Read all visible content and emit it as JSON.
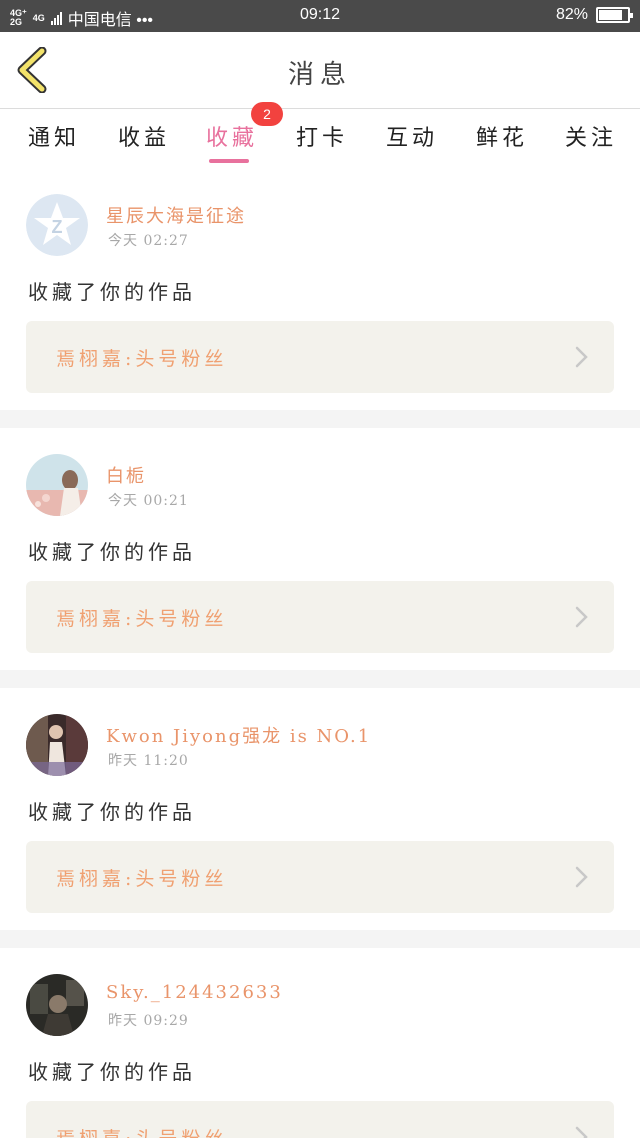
{
  "status_bar": {
    "network_a": "4G⁺",
    "network_b": "4G",
    "network_c": "2G",
    "carrier": "中国电信 •••",
    "time": "09:12",
    "battery_text": "82%",
    "battery_level": 0.82
  },
  "nav": {
    "title": "消息"
  },
  "tabs": [
    {
      "label": "通知"
    },
    {
      "label": "收益"
    },
    {
      "label": "收藏",
      "badge": "2"
    },
    {
      "label": "打卡"
    },
    {
      "label": "互动"
    },
    {
      "label": "鲜花"
    },
    {
      "label": "关注"
    }
  ],
  "colors": {
    "accent_pink": "#e8719d",
    "badge_red": "#f2423f",
    "username_orange": "#e9946a",
    "work_orange": "#f0a071",
    "card_bg": "#f3f2ec"
  },
  "items": [
    {
      "username": "星辰大海是征途",
      "time": "今天 02:27",
      "action": "收藏了你的作品",
      "work": "焉栩嘉:头号粉丝",
      "avatar": "qq-default-avatar"
    },
    {
      "username": "白栀",
      "time": "今天 00:21",
      "action": "收藏了你的作品",
      "work": "焉栩嘉:头号粉丝",
      "avatar": "photo-avatar-girl"
    },
    {
      "username": "Kwon Jiyong强龙 is NO.1",
      "time": "昨天 11:20",
      "action": "收藏了你的作品",
      "work": "焉栩嘉:头号粉丝",
      "avatar": "photo-avatar-person"
    },
    {
      "username": "Sky._124432633",
      "time": "昨天 09:29",
      "action": "收藏了你的作品",
      "work": "焉栩嘉:头号粉丝",
      "avatar": "photo-avatar-dark"
    }
  ]
}
